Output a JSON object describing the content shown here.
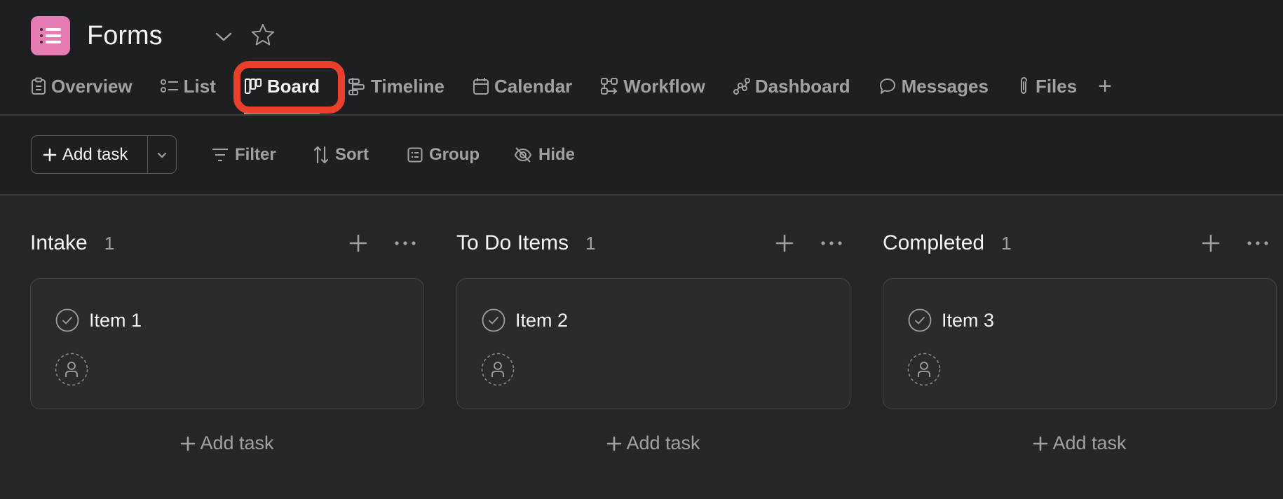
{
  "project": {
    "title": "Forms",
    "icon": "list-icon",
    "icon_color": "#e57cb3"
  },
  "tabs": [
    {
      "label": "Overview",
      "icon": "clipboard-icon",
      "active": false
    },
    {
      "label": "List",
      "icon": "list-icon",
      "active": false
    },
    {
      "label": "Board",
      "icon": "board-icon",
      "active": true
    },
    {
      "label": "Timeline",
      "icon": "timeline-icon",
      "active": false
    },
    {
      "label": "Calendar",
      "icon": "calendar-icon",
      "active": false
    },
    {
      "label": "Workflow",
      "icon": "workflow-icon",
      "active": false
    },
    {
      "label": "Dashboard",
      "icon": "dashboard-icon",
      "active": false
    },
    {
      "label": "Messages",
      "icon": "message-icon",
      "active": false
    },
    {
      "label": "Files",
      "icon": "paperclip-icon",
      "active": false
    }
  ],
  "tab_add_label": "+",
  "highlight_color": "#e8402a",
  "toolbar": {
    "add_task_label": "Add task",
    "filter_label": "Filter",
    "sort_label": "Sort",
    "group_label": "Group",
    "hide_label": "Hide"
  },
  "columns": [
    {
      "title": "Intake",
      "count": "1",
      "cards": [
        {
          "title": "Item 1"
        }
      ],
      "add_label": "Add task"
    },
    {
      "title": "To Do Items",
      "count": "1",
      "cards": [
        {
          "title": "Item 2"
        }
      ],
      "add_label": "Add task"
    },
    {
      "title": "Completed",
      "count": "1",
      "cards": [
        {
          "title": "Item 3"
        }
      ],
      "add_label": "Add task"
    }
  ]
}
